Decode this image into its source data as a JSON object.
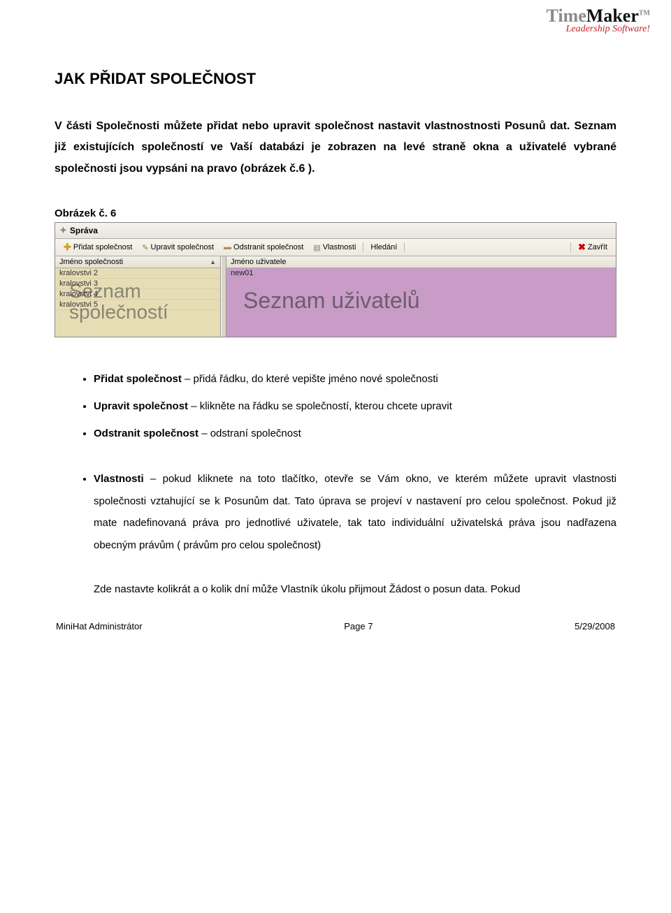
{
  "logo": {
    "time": "Time",
    "maker": "Maker",
    "tm": "TM",
    "sub": "Leadership Software!"
  },
  "heading": "JAK PŘIDAT SPOLEČNOST",
  "intro": "V části Společnosti můžete přidat nebo upravit společnost nastavit vlastnostnosti Posunů dat. Seznam již existujících společností ve Vaší databázi je zobrazen na levé straně okna a uživatelé vybrané společnosti jsou vypsáni na pravo (obrázek č.6 ).",
  "caption": "Obrázek č. 6",
  "app": {
    "title": "Správa",
    "toolbar": {
      "add": "Přidat společnost",
      "edit": "Upravit společnost",
      "remove": "Odstranit společnost",
      "props": "Vlastnosti",
      "search": "Hledání",
      "close": "Zavřít"
    },
    "left_header": "Jméno společnosti",
    "right_header": "Jméno uživatele",
    "left_rows": [
      "kralovstvi 2",
      "kralovstvi 3",
      "kralovstvi 4",
      "kralovstvi 5"
    ],
    "right_rows": [
      "new01"
    ],
    "overlay_left_l1": "Seznam",
    "overlay_left_l2": "společností",
    "overlay_right": "Seznam uživatelů"
  },
  "bullets1": [
    {
      "term": "Přidat společnost",
      "desc": " – přidá řádku, do které vepište jméno nové společnosti"
    },
    {
      "term": "Upravit společnost",
      "desc": " – klikněte na řádku se společností, kterou chcete upravit"
    },
    {
      "term": "Odstranit společnost",
      "desc": " – odstraní společnost"
    }
  ],
  "bullets2": [
    {
      "term": "Vlastnosti",
      "desc": " – pokud kliknete na toto tlačítko, otevře se Vám okno, ve kterém můžete upravit vlastnosti společnosti vztahující se k Posunům dat. Tato úprava se projeví v nastavení pro celou společnost. Pokud již mate nadefinovaná práva pro jednotlivé uživatele, tak tato individuální uživatelská práva jsou nadřazena obecným právům ( právům pro celou společnost)",
      "extra": "Zde nastavte kolikrát a o kolik dní může Vlastník úkolu přijmout Žádost o posun data. Pokud"
    }
  ],
  "footer": {
    "left": "MiniHat Administrátor",
    "center": "Page 7",
    "right": "5/29/2008"
  }
}
